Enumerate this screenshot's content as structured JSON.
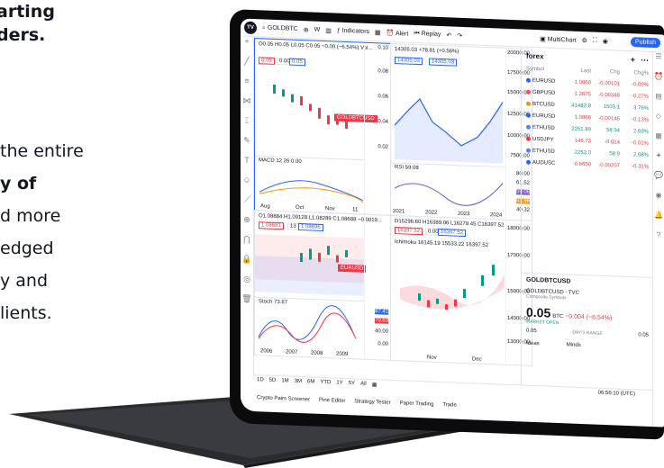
{
  "hero": {
    "line1": "arting",
    "line2": "ders.",
    "body_lines": [
      "the entire",
      "y of",
      "d more",
      "edged",
      "y and",
      "lients."
    ]
  },
  "toolbar": {
    "symbol": "GOLDBTC",
    "interval": "W",
    "indicators": "Indicators",
    "alert": "Alert",
    "replay": "Replay",
    "multichart": "MultiChart",
    "publish": "Publish"
  },
  "charts": {
    "main": {
      "legend": "O0.05 H0.05 L0.05 C0.05 −0.00 (−6.54%) Vol...",
      "pills": [
        "0.05",
        "0.00",
        "0.05"
      ],
      "price_ticks": [
        "0.10",
        "0.08",
        "0.06",
        "0.04",
        "0.02"
      ],
      "badge": "GOLDBTCUSD",
      "macd": "MACD 12 26 0.00",
      "x_ticks": [
        "Aug",
        "Oct",
        "Nov",
        "11"
      ]
    },
    "top_right": {
      "legend": "14305.03 +78.81 (+0.56%)",
      "pills": [
        "14305.03",
        "14305.03"
      ],
      "price_ticks": [
        "20000.00",
        "17500.00",
        "15000.00",
        "12500.00",
        "10000.00",
        "7500.00"
      ],
      "rsi": "RSI 59.08",
      "rsi_ticks": [
        "80.00",
        "61.52",
        "59.08",
        "52.98",
        "40.32"
      ],
      "x_ticks": [
        "2021",
        "2022",
        "2023",
        "2024"
      ]
    },
    "bottom_left": {
      "legend": "O1.08884 H1.09128 L1.08289 C1.08688 −0.0019...",
      "pills": [
        "1.08681",
        "13",
        "1.08696"
      ],
      "badge": "EURUSD",
      "stoch": "Stoch 73.67",
      "stoch_ticks": [
        "87.41",
        "70.63",
        "40.00",
        "0.00"
      ],
      "x_ticks": [
        "2006",
        "2007",
        "2008",
        "2009"
      ]
    },
    "bottom_right": {
      "legend": "D15296.60 H16389.06 L16279.45 C16397.52",
      "pills": [
        "16397.52",
        "0.00",
        "16397.52"
      ],
      "ichimoku": "Ichimoku 16145.19 15533.22 16397.52",
      "price_ticks": [
        "18000.00",
        "17000.00",
        "15000.00",
        "14000.00",
        "13000.00"
      ],
      "x_ticks": [
        "Nov",
        "Dec"
      ]
    }
  },
  "timeframes": [
    "1D",
    "5D",
    "1M",
    "3M",
    "6M",
    "YTD",
    "1Y",
    "5Y",
    "All"
  ],
  "clock": "06:56:10 (UTC)",
  "bottom_tabs": [
    "Crypto Pairs Screener",
    "Pine Editor",
    "Strategy Tester",
    "Paper Trading",
    "Trade"
  ],
  "watchlist": {
    "title": "forex",
    "columns": [
      "Symbol",
      "Last",
      "Chg",
      "Chg%"
    ],
    "rows": [
      {
        "sym": "EURUSD",
        "last": "1.0868",
        "chg": "-0.00101",
        "pct": "-0.09%",
        "color": "#f23645",
        "dot": "#2962ff"
      },
      {
        "sym": "GBPUSD",
        "last": "1.2675",
        "chg": "-0.00348",
        "pct": "-0.27%",
        "color": "#f23645",
        "dot": "#f7525f"
      },
      {
        "sym": "BTCUSD",
        "last": "41482.8",
        "chg": "1503.1",
        "pct": "3.76%",
        "color": "#089981",
        "dot": "#f7931a"
      },
      {
        "sym": "EURUSD",
        "last": "1.0868",
        "chg": "-0.00145",
        "pct": "-0.13%",
        "color": "#f23645",
        "dot": "#2962ff"
      },
      {
        "sym": "ETHUSD",
        "last": "2251.89",
        "chg": "58.94",
        "pct": "2.69%",
        "color": "#089981",
        "dot": "#627eea"
      },
      {
        "sym": "USDJPY",
        "last": "146.73",
        "chg": "-0.014",
        "pct": "-0.01%",
        "color": "#f23645",
        "dot": "#f23645"
      },
      {
        "sym": "ETHUSD",
        "last": "2253.0",
        "chg": "58.9",
        "pct": "2.68%",
        "color": "#089981",
        "dot": "#627eea"
      },
      {
        "sym": "AUDUSC",
        "last": "0.6650",
        "chg": "-0.00207",
        "pct": "-0.31%",
        "color": "#f23645",
        "dot": "#2962ff"
      }
    ]
  },
  "detail": {
    "symbol": "GOLDBTCUSD",
    "sub": "GOLDBTCUSD · TVC",
    "category": "Composite Symbols",
    "price": "0.05",
    "unit": "BTC",
    "change": "−0.004 (−6.54%)",
    "status": "MARKET OPEN",
    "range_low": "0.05",
    "range_label": "DAY'S RANGE",
    "range_high": "0.05",
    "ideas": "Ideas",
    "minds": "Minds"
  }
}
